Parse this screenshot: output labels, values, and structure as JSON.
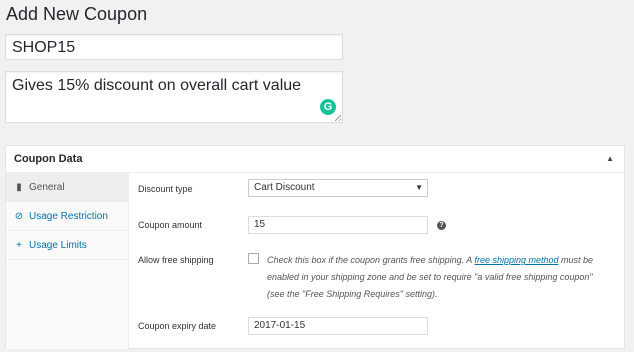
{
  "page_title": "Add New Coupon",
  "coupon_code": "SHOP15",
  "description": "Gives 15% discount on overall cart value",
  "panel": {
    "title": "Coupon Data",
    "tabs": [
      {
        "label": "General",
        "icon": "ticket-icon",
        "active": true
      },
      {
        "label": "Usage Restriction",
        "icon": "ban-icon",
        "active": false
      },
      {
        "label": "Usage Limits",
        "icon": "plus-icon",
        "active": false
      }
    ],
    "fields": {
      "discount_type_label": "Discount type",
      "discount_type_value": "Cart Discount",
      "coupon_amount_label": "Coupon amount",
      "coupon_amount_value": "15",
      "free_shipping_label": "Allow free shipping",
      "free_shipping_desc_before": "Check this box if the coupon grants free shipping. A ",
      "free_shipping_link": "free shipping method",
      "free_shipping_desc_after": " must be enabled in your shipping zone and be set to require \"a valid free shipping coupon\" (see the \"Free Shipping Requires\" setting).",
      "expiry_label": "Coupon expiry date",
      "expiry_value": "2017-01-15"
    }
  }
}
